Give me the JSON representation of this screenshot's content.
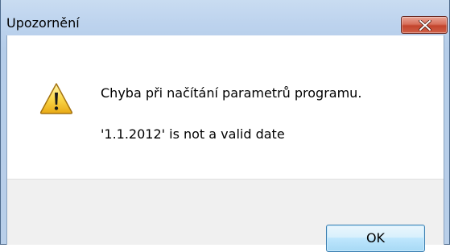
{
  "window": {
    "title": "Upozornění",
    "close_icon": "close-icon"
  },
  "message": {
    "icon": "warning-icon",
    "line1": "Chyba při načítání parametrů programu.",
    "line2": "'1.1.2012' is not a valid date"
  },
  "buttons": {
    "ok_label": "OK"
  },
  "colors": {
    "title_bar": "#bdd3ee",
    "close_button": "#c3452d",
    "ok_button_border": "#3c7fb1",
    "footer_background": "#f0f0f0"
  }
}
